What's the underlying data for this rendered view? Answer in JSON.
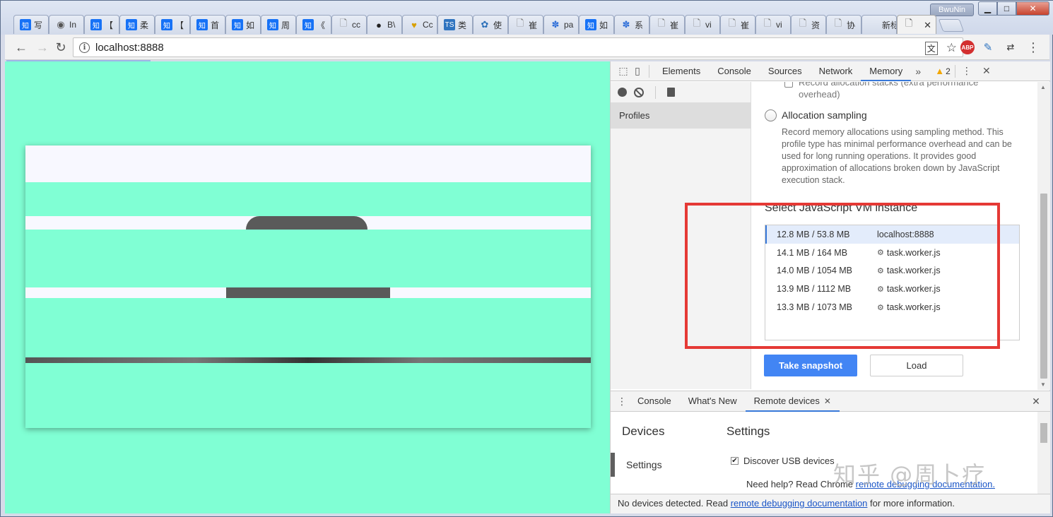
{
  "window": {
    "user_badge": "BwuNin",
    "min_glyph": "▁",
    "max_glyph": "□",
    "close_glyph": "✕"
  },
  "tabs": [
    {
      "title": "写",
      "icon": "知",
      "color": "#1772f6"
    },
    {
      "title": "In",
      "icon": "◉",
      "color": "#555555"
    },
    {
      "title": "【",
      "icon": "知",
      "color": "#1772f6"
    },
    {
      "title": "柔",
      "icon": "知",
      "color": "#1772f6"
    },
    {
      "title": "【",
      "icon": "知",
      "color": "#1772f6"
    },
    {
      "title": "首",
      "icon": "知",
      "color": "#1772f6"
    },
    {
      "title": "如",
      "icon": "知",
      "color": "#1772f6"
    },
    {
      "title": "周",
      "icon": "知",
      "color": "#1772f6"
    },
    {
      "title": "《",
      "icon": "知",
      "color": "#1772f6"
    },
    {
      "title": "cc",
      "icon": "🗋",
      "color": "#777777"
    },
    {
      "title": "B\\",
      "icon": "●",
      "color": "#222222"
    },
    {
      "title": "Cc",
      "icon": "♥",
      "color": "#d8a000"
    },
    {
      "title": "类",
      "icon": "TS",
      "color": "#2f74c0"
    },
    {
      "title": "使",
      "icon": "✿",
      "color": "#2a6fb8"
    },
    {
      "title": "崔",
      "icon": "🗋",
      "color": "#777777"
    },
    {
      "title": "pa",
      "icon": "✽",
      "color": "#2f6fd8"
    },
    {
      "title": "如",
      "icon": "知",
      "color": "#1772f6"
    },
    {
      "title": "系",
      "icon": "✽",
      "color": "#2f6fd8"
    },
    {
      "title": "崔",
      "icon": "🗋",
      "color": "#777777"
    },
    {
      "title": "vi",
      "icon": "🗋",
      "color": "#777777"
    },
    {
      "title": "崔",
      "icon": "🗋",
      "color": "#777777"
    },
    {
      "title": "vi",
      "icon": "🗋",
      "color": "#777777"
    },
    {
      "title": "资",
      "icon": "🗋",
      "color": "#777777"
    },
    {
      "title": "协",
      "icon": "🗋",
      "color": "#777777"
    },
    {
      "title": "新标签",
      "icon": "",
      "color": "#777777"
    }
  ],
  "active_tab": {
    "title": "",
    "icon": "🗋",
    "close": "✕"
  },
  "toolbar": {
    "back": "←",
    "forward": "→",
    "reload": "↻",
    "url": "localhost:8888",
    "info_icon": "i",
    "translate_icon": "文",
    "star_icon": "☆",
    "abp_label": "ABP",
    "menu_icon": "⋮"
  },
  "devtools": {
    "tabs": [
      "Elements",
      "Console",
      "Sources",
      "Network",
      "Memory"
    ],
    "active_tab": "Memory",
    "more": "»",
    "warnings": "2",
    "kebab": "⋮",
    "close": "✕",
    "sidebar": {
      "items": [
        "Profiles"
      ]
    },
    "memory": {
      "clipped_text": "Record allocation stacks (extra performance overhead)",
      "option_label": "Allocation sampling",
      "option_desc": "Record memory allocations using sampling method. This profile type has minimal performance overhead and can be used for long running operations. It provides good approximation of allocations broken down by JavaScript execution stack.",
      "vm_title": "Select JavaScript VM instance",
      "vm_instances": [
        {
          "size": "12.8 MB / 53.8 MB",
          "name": "localhost:8888",
          "worker": false,
          "selected": true
        },
        {
          "size": "14.1 MB / 164 MB",
          "name": "task.worker.js",
          "worker": true,
          "selected": false
        },
        {
          "size": "14.0 MB / 1054 MB",
          "name": "task.worker.js",
          "worker": true,
          "selected": false
        },
        {
          "size": "13.9 MB / 1112 MB",
          "name": "task.worker.js",
          "worker": true,
          "selected": false
        },
        {
          "size": "13.3 MB / 1073 MB",
          "name": "task.worker.js",
          "worker": true,
          "selected": false
        }
      ],
      "take_snapshot": "Take snapshot",
      "load": "Load"
    },
    "drawer": {
      "tabs": [
        "Console",
        "What's New",
        "Remote devices"
      ],
      "active_tab": "Remote devices",
      "devices_heading": "Devices",
      "settings_nav": "Settings",
      "settings_heading": "Settings",
      "usb_label": "Discover USB devices",
      "usb_checked": true,
      "help_prefix": "Need help? Read Chrome ",
      "help_link": "remote debugging documentation.",
      "status_prefix": "No devices detected. Read ",
      "status_link": "remote debugging documentation",
      "status_suffix": " for more information."
    }
  },
  "watermark": "知乎 @周卜疗",
  "colors": {
    "page_bg": "#80ffd4",
    "accent": "#4285f4",
    "highlight": "#e53935"
  }
}
